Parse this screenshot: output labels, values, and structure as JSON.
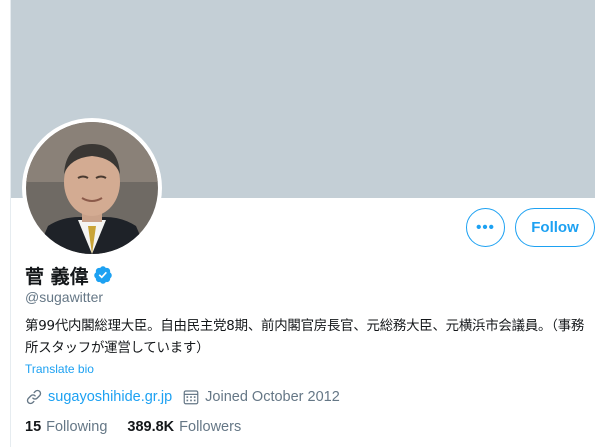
{
  "profile": {
    "display_name": "菅 義偉",
    "handle": "@sugawitter",
    "bio": "第99代内閣総理大臣。自由民主党8期、前内閣官房長官、元総務大臣、元横浜市会議員。（事務所スタッフが運営しています）",
    "translate_label": "Translate bio",
    "website": "sugayoshihide.gr.jp",
    "joined": "Joined October 2012",
    "following_count": "15",
    "following_label": "Following",
    "followers_count": "389.8K",
    "followers_label": "Followers"
  },
  "actions": {
    "more_label": "•••",
    "follow_label": "Follow"
  },
  "icons": {
    "verified": "verified-badge-icon",
    "website": "link-icon",
    "joined": "calendar-icon"
  },
  "colors": {
    "accent": "#1da1f2",
    "banner": "#c4cfd6",
    "secondary_text": "#657786",
    "primary_text": "#14171a"
  }
}
